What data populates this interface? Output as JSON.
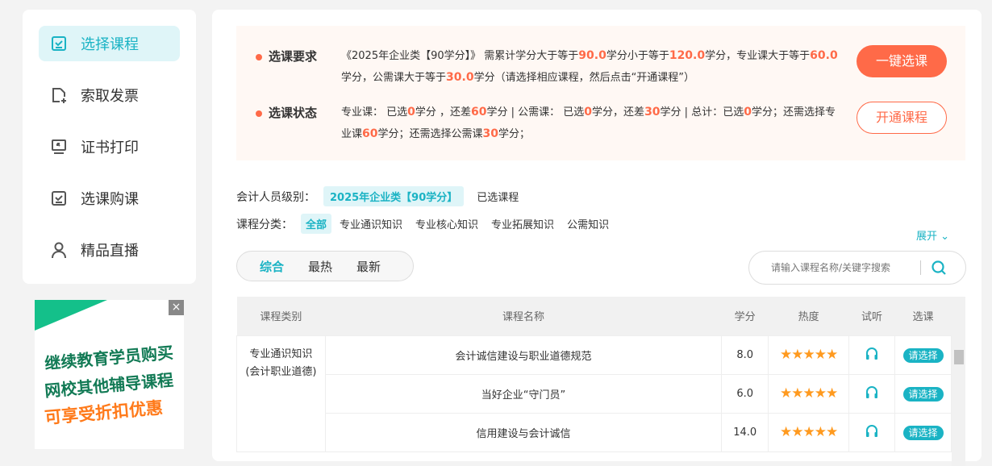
{
  "sidebar": {
    "items": [
      {
        "label": "选择课程",
        "icon": "checkbox-icon"
      },
      {
        "label": "索取发票",
        "icon": "file-plus-icon"
      },
      {
        "label": "证书打印",
        "icon": "monitor-icon"
      },
      {
        "label": "选课购课",
        "icon": "checkbox-icon"
      },
      {
        "label": "精品直播",
        "icon": "user-icon"
      }
    ]
  },
  "ad": {
    "line1": "继续教育学员购买",
    "line2": "网校其他辅导课程",
    "line3": "可享受折扣优惠",
    "close": "×"
  },
  "requirement": {
    "label": "选课要求",
    "t1": "《2025年企业类【90学分】》 需累计学分大于等于",
    "v1": "90.0",
    "t2": "学分小于等于",
    "v2": "120.0",
    "t3": "学分，专业课大于等于",
    "v3": "60.0",
    "t4": "学分，公需课大于等于",
    "v4": "30.0",
    "t5": "学分（请选择相应课程，然后点击“开通课程”）"
  },
  "status": {
    "label": "选课状态",
    "t1": "专业课： 已选",
    "v1": "0",
    "t2": "学分 ，还差",
    "v2": "60",
    "t3": "学分 | 公需课： 已选",
    "v3": "0",
    "t4": "学分，还差",
    "v4": "30",
    "t5": "学分 | 总计：已选",
    "v5": "0",
    "t6": "学分；还需选择专业课",
    "v6": "60",
    "t7": "学分；还需选择公需课",
    "v7": "30",
    "t8": "学分；"
  },
  "buttons": {
    "one_click": "一键选课",
    "open": "开通课程"
  },
  "level": {
    "label": "会计人员级别：",
    "selected": "2025年企业类【90学分】",
    "other": "已选课程"
  },
  "category": {
    "label": "课程分类：",
    "items": [
      "全部",
      "专业通识知识",
      "专业核心知识",
      "专业拓展知识",
      "公需知识"
    ]
  },
  "expand": "展开",
  "sort": [
    "综合",
    "最热",
    "最新"
  ],
  "search": {
    "placeholder": "请输入课程名称/关键字搜索"
  },
  "table": {
    "headers": [
      "课程类别",
      "课程名称",
      "学分",
      "热度",
      "试听",
      "选课"
    ],
    "group": "专业通识知识\n(会计职业道德)",
    "rows": [
      {
        "name": "会计诚信建设与职业道德规范",
        "credit": "8.0",
        "stars": 5,
        "action": "请选择"
      },
      {
        "name": "当好企业“守门员”",
        "credit": "6.0",
        "stars": 5,
        "action": "请选择"
      },
      {
        "name": "信用建设与会计诚信",
        "credit": "14.0",
        "stars": 5,
        "action": "请选择"
      }
    ]
  },
  "colors": {
    "accent": "#1ab3c4",
    "orange": "#ff6a48"
  }
}
